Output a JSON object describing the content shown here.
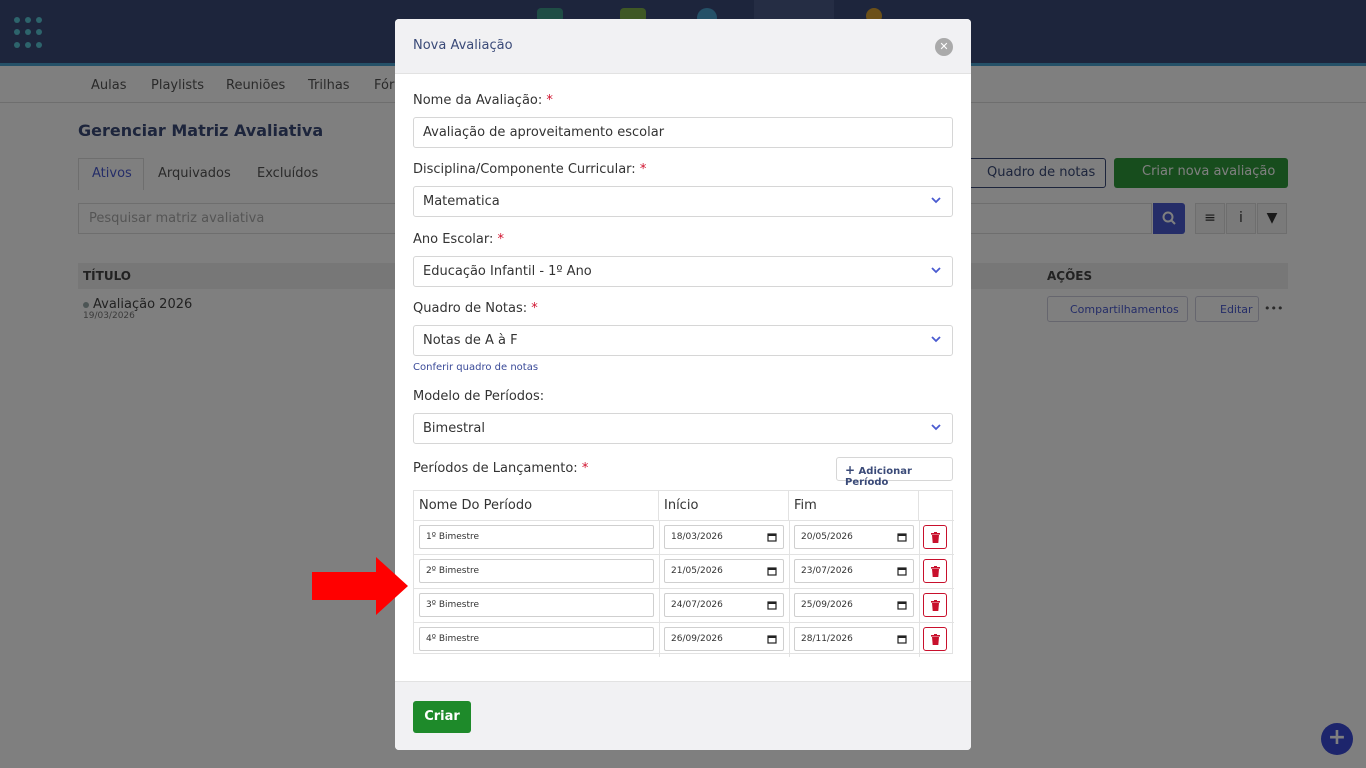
{
  "background": {
    "subnav": [
      "Aulas",
      "Playlists",
      "Reuniões",
      "Trilhas",
      "Fór"
    ],
    "page_title": "Gerenciar Matriz Avaliativa",
    "tabs": [
      "Ativos",
      "Arquivados",
      "Excluídos"
    ],
    "quadro_button": "Quadro de notas",
    "criar_nova_button": "Criar nova avaliação",
    "search_placeholder": "Pesquisar matriz avaliativa",
    "columns": {
      "titulo": "TÍTULO",
      "acoes": "AÇÕES"
    },
    "row": {
      "title": "Avaliação 2026",
      "date": "19/03/2026",
      "share_button": "Compartilhamentos",
      "edit_button": "Editar",
      "more": "•••"
    }
  },
  "modal": {
    "title": "Nova Avaliação",
    "fields": {
      "nome": {
        "label": "Nome da Avaliação:",
        "value": "Avaliação de aproveitamento escolar"
      },
      "disciplina": {
        "label": "Disciplina/Componente Curricular:",
        "value": "Matematica"
      },
      "ano": {
        "label": "Ano Escolar:",
        "value": "Educação Infantil - 1º Ano"
      },
      "quadro": {
        "label": "Quadro de Notas:",
        "value": "Notas de A à F"
      },
      "modelo": {
        "label": "Modelo de Períodos:",
        "value": "Bimestral"
      }
    },
    "required_mark": "*",
    "conferir_link": "Conferir quadro de notas",
    "periodos_label": "Períodos de Lançamento:",
    "add_periodo_button": "Adicionar Período",
    "periodos_columns": {
      "nome": "Nome Do Período",
      "inicio": "Início",
      "fim": "Fim"
    },
    "periodos": [
      {
        "nome": "1º Bimestre",
        "inicio": "18/03/2026",
        "fim": "20/05/2026"
      },
      {
        "nome": "2º Bimestre",
        "inicio": "21/05/2026",
        "fim": "23/07/2026"
      },
      {
        "nome": "3º Bimestre",
        "inicio": "24/07/2026",
        "fim": "25/09/2026"
      },
      {
        "nome": "4º Bimestre",
        "inicio": "26/09/2026",
        "fim": "28/11/2026"
      }
    ],
    "submit_button": "Criar"
  },
  "colors": {
    "brand": "#3a4a78",
    "accent": "#4a5bd0",
    "success": "#1e8a2a",
    "danger": "#c8102c",
    "annotation_arrow": "#ff0000"
  }
}
